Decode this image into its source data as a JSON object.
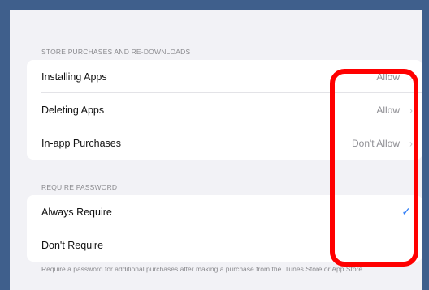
{
  "sections": [
    {
      "header": "STORE PURCHASES AND RE-DOWNLOADS",
      "rows": [
        {
          "label": "Installing Apps",
          "value": "Allow",
          "accessory": "chevron"
        },
        {
          "label": "Deleting Apps",
          "value": "Allow",
          "accessory": "chevron"
        },
        {
          "label": "In-app Purchases",
          "value": "Don't Allow",
          "accessory": "chevron"
        }
      ]
    },
    {
      "header": "REQUIRE PASSWORD",
      "rows": [
        {
          "label": "Always Require",
          "selected": true
        },
        {
          "label": "Don't Require",
          "selected": false
        }
      ]
    }
  ],
  "footer": "Require a password for additional purchases after making a purchase from the iTunes Store or App Store.",
  "glyphs": {
    "chevron": "›",
    "check": "✓"
  },
  "colors": {
    "accent": "#2f7df6",
    "highlight": "#ff0000",
    "frame": "#3f5f8c",
    "background": "#f2f2f6"
  },
  "annotation": {
    "type": "highlight-rounded-rectangle"
  }
}
